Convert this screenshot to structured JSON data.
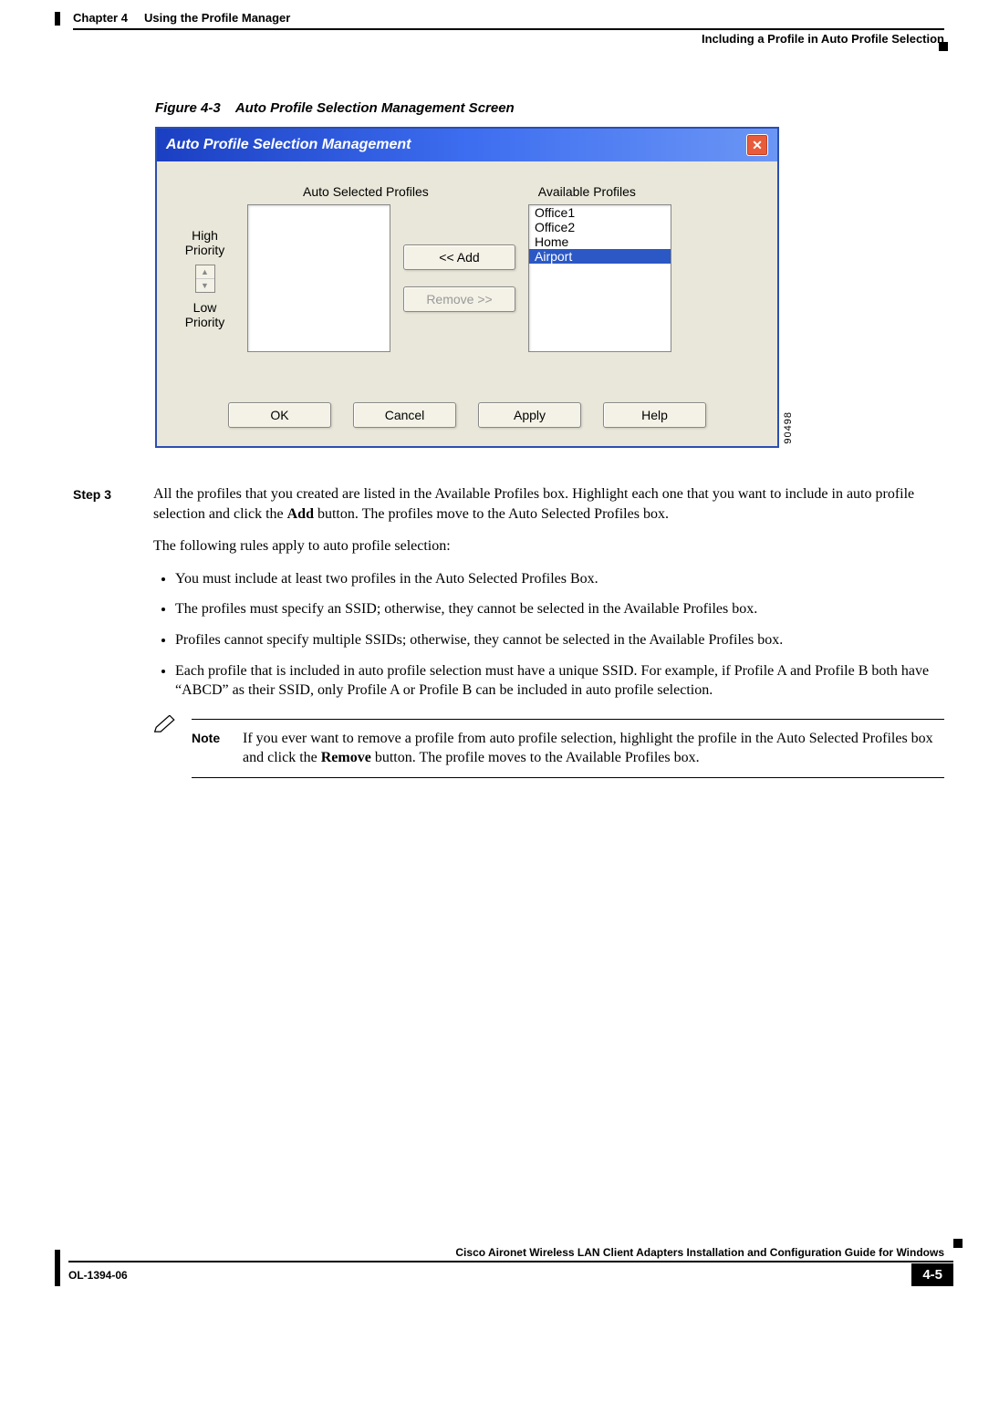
{
  "header": {
    "chapter": "Chapter 4",
    "chapter_title": "Using the Profile Manager",
    "section": "Including a Profile in Auto Profile Selection"
  },
  "figure": {
    "caption_prefix": "Figure 4-3",
    "caption_text": "Auto Profile Selection Management Screen"
  },
  "dialog": {
    "title": "Auto Profile Selection Management",
    "close_glyph": "✕",
    "auto_label": "Auto Selected Profiles",
    "avail_label": "Available Profiles",
    "high_label": "High Priority",
    "low_label": "Low Priority",
    "add_btn": "<<  Add",
    "remove_btn": "Remove >>",
    "available_items": [
      "Office1",
      "Office2",
      "Home",
      "Airport"
    ],
    "selected_index": 3,
    "buttons": {
      "ok": "OK",
      "cancel": "Cancel",
      "apply": "Apply",
      "help": "Help"
    },
    "side_code": "90498"
  },
  "step": {
    "label": "Step 3",
    "para1_a": "All the profiles that you created are listed in the Available Profiles box. Highlight each one that you want to include in auto profile selection and click the ",
    "para1_bold": "Add",
    "para1_b": " button. The profiles move to the Auto Selected Profiles box.",
    "para2": "The following rules apply to auto profile selection:",
    "bullets": [
      "You must include at least two profiles in the Auto Selected Profiles Box.",
      "The profiles must specify an SSID; otherwise, they cannot be selected in the Available Profiles box.",
      "Profiles cannot specify multiple SSIDs; otherwise, they cannot be selected in the Available Profiles box.",
      "Each profile that is included in auto profile selection must have a unique SSID. For example, if Profile A and Profile B both have “ABCD” as their SSID, only Profile A or Profile B can be included in auto profile selection."
    ]
  },
  "note": {
    "label": "Note",
    "text_a": "If you ever want to remove a profile from auto profile selection, highlight the profile in the Auto Selected Profiles box and click the ",
    "text_bold": "Remove",
    "text_b": " button. The profile moves to the Available Profiles box."
  },
  "footer": {
    "doc_title": "Cisco Aironet Wireless LAN Client Adapters Installation and Configuration Guide for Windows",
    "doc_id": "OL-1394-06",
    "page_num": "4-5"
  }
}
